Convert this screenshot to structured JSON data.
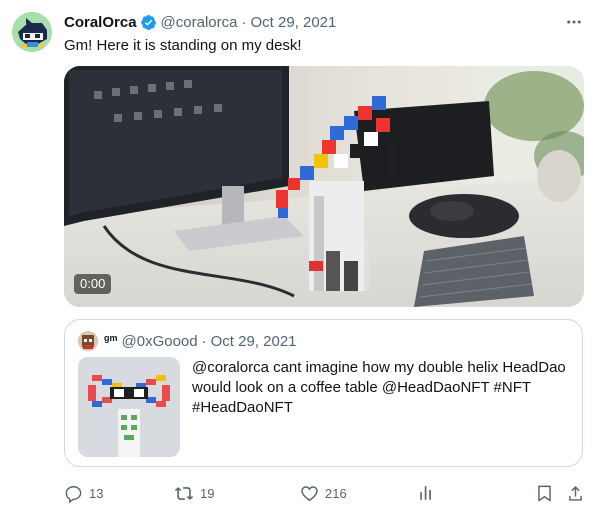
{
  "tweet": {
    "display_name": "CoralOrca",
    "handle": "@coralorca",
    "separator": "·",
    "date": "Oct 29, 2021",
    "text": "Gm! Here it is standing on my desk!",
    "video": {
      "time": "0:00"
    }
  },
  "quote": {
    "display_name": "gm",
    "handle": "@0xGoood",
    "separator": "·",
    "date": "Oct 29, 2021",
    "text": "@coralorca cant imagine how my double helix HeadDao would look on a coffee table @HeadDaoNFT #NFT #HeadDaoNFT"
  },
  "actions": {
    "replies": "13",
    "retweets": "19",
    "likes": "216"
  },
  "icons": {
    "verified": "verified-badge-icon",
    "more": "more-icon",
    "reply": "reply-icon",
    "retweet": "retweet-icon",
    "like": "heart-icon",
    "views": "views-icon",
    "bookmark": "bookmark-icon",
    "share": "share-icon"
  },
  "colors": {
    "text": "#0f1419",
    "secondary": "#536471",
    "verified": "#1d9bf0",
    "border": "#cfd9de"
  }
}
